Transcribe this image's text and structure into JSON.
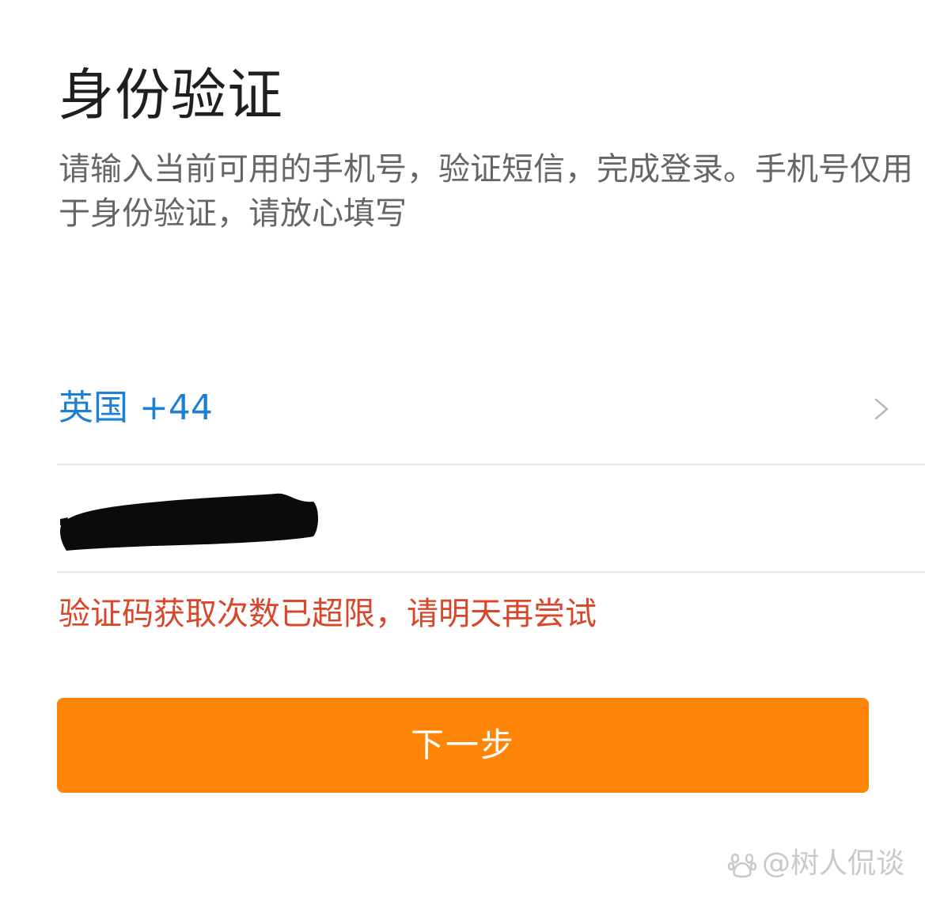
{
  "header": {
    "title": "身份验证",
    "description": "请输入当前可用的手机号，验证短信，完成登录。手机号仅用于身份验证，请放心填写"
  },
  "country_selector": {
    "label": "英国 +44",
    "icon": "chevron-right-icon"
  },
  "phone_field": {
    "value": "",
    "redacted": true
  },
  "error_message": "验证码获取次数已超限，请明天再尝试",
  "next_button": {
    "label": "下一步"
  },
  "watermark": {
    "text": "@树人侃谈",
    "icon": "baidu-paw-icon"
  },
  "colors": {
    "link_blue": "#1d7fd6",
    "error_red": "#d9472b",
    "button_orange": "#ff8508",
    "divider": "#e6e6e6"
  }
}
